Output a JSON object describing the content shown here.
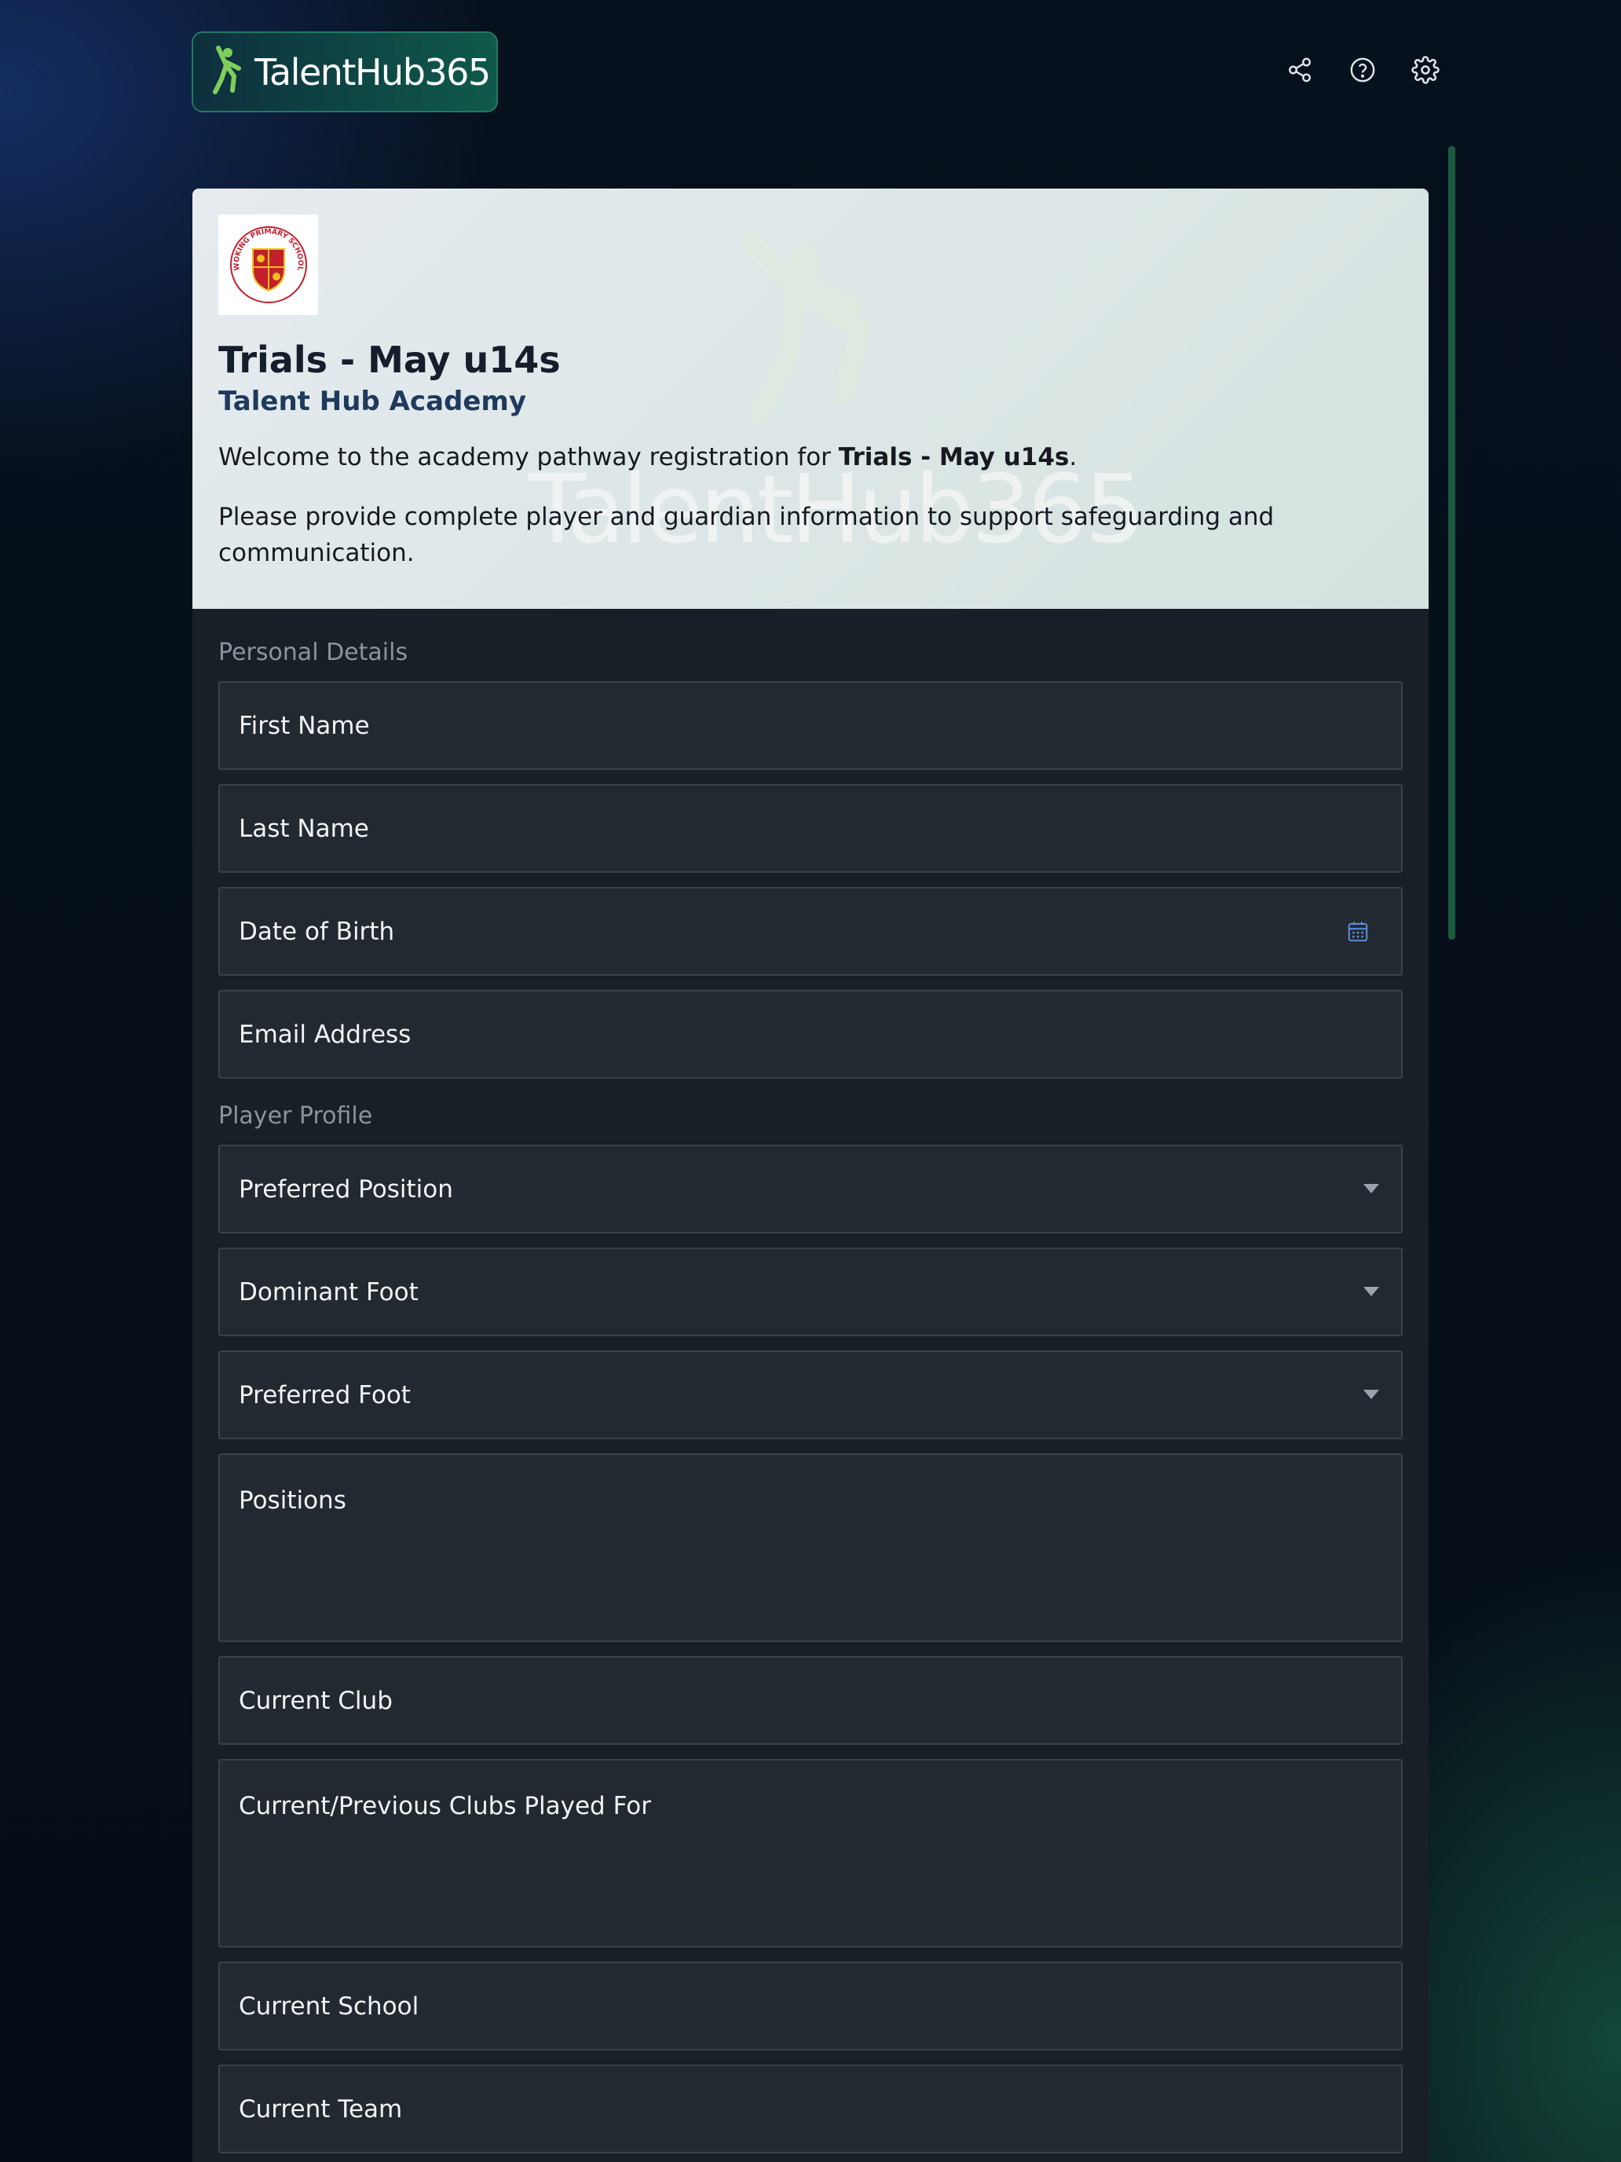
{
  "brand": {
    "name": "TalentHub365"
  },
  "header": {
    "icons": [
      "share-icon",
      "help-icon",
      "settings-icon"
    ]
  },
  "hero": {
    "crest_text": "WOKING PRIMARY SCHOOLS F.A.",
    "watermark": "TalentHub365",
    "title": "Trials - May u14s",
    "subtitle": "Talent Hub Academy",
    "welcome_prefix": "Welcome to the academy pathway registration for ",
    "welcome_bold": "Trials - May u14s",
    "welcome_suffix": ".",
    "instructions": "Please provide complete player and guardian information to support safeguarding and communication."
  },
  "sections": {
    "personal": {
      "label": "Personal Details",
      "fields": [
        "First Name",
        "Last Name",
        "Date of Birth",
        "Email Address"
      ]
    },
    "profile": {
      "label": "Player Profile",
      "fields": [
        "Preferred Position",
        "Dominant Foot",
        "Preferred Foot",
        "Positions",
        "Current Club",
        "Current/Previous Clubs Played For",
        "Current School",
        "Current Team"
      ]
    }
  },
  "colors": {
    "accent_green": "#1f7a63",
    "card_bg": "#191f26",
    "field_bg": "#222931",
    "calendar_icon": "#5b8fe0"
  }
}
